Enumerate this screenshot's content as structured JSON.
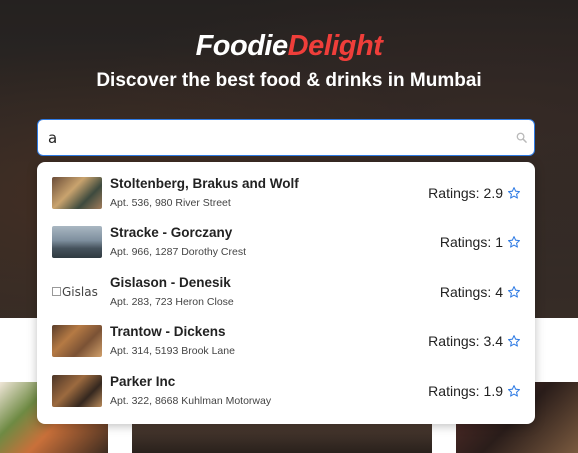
{
  "brand": {
    "part1": "Foodie",
    "part2": "Delight",
    "accent_color": "#ef3e3a"
  },
  "tagline": "Discover the best food & drinks in Mumbai",
  "search": {
    "value": "a",
    "icon": "search-icon",
    "focus_color": "#2f7be4"
  },
  "results": [
    {
      "name": "Stoltenberg, Brakus and Wolf",
      "address": "Apt. 536, 980 River Street",
      "rating_label": "Ratings:",
      "rating": "2.9",
      "image_alt": ""
    },
    {
      "name": "Stracke - Gorczany",
      "address": "Apt. 966, 1287 Dorothy Crest",
      "rating_label": "Ratings:",
      "rating": "1",
      "image_alt": ""
    },
    {
      "name": "Gislason - Denesik",
      "address": "Apt. 283, 723 Heron Close",
      "rating_label": "Ratings:",
      "rating": "4",
      "image_alt": "Gislas"
    },
    {
      "name": "Trantow - Dickens",
      "address": "Apt. 314, 5193 Brook Lane",
      "rating_label": "Ratings:",
      "rating": "3.4",
      "image_alt": ""
    },
    {
      "name": "Parker Inc",
      "address": "Apt. 322, 8668 Kuhlman Motorway",
      "rating_label": "Ratings:",
      "rating": "1.9",
      "image_alt": ""
    }
  ],
  "star_icon": "star-outline-icon",
  "star_color": "#2f7be4"
}
